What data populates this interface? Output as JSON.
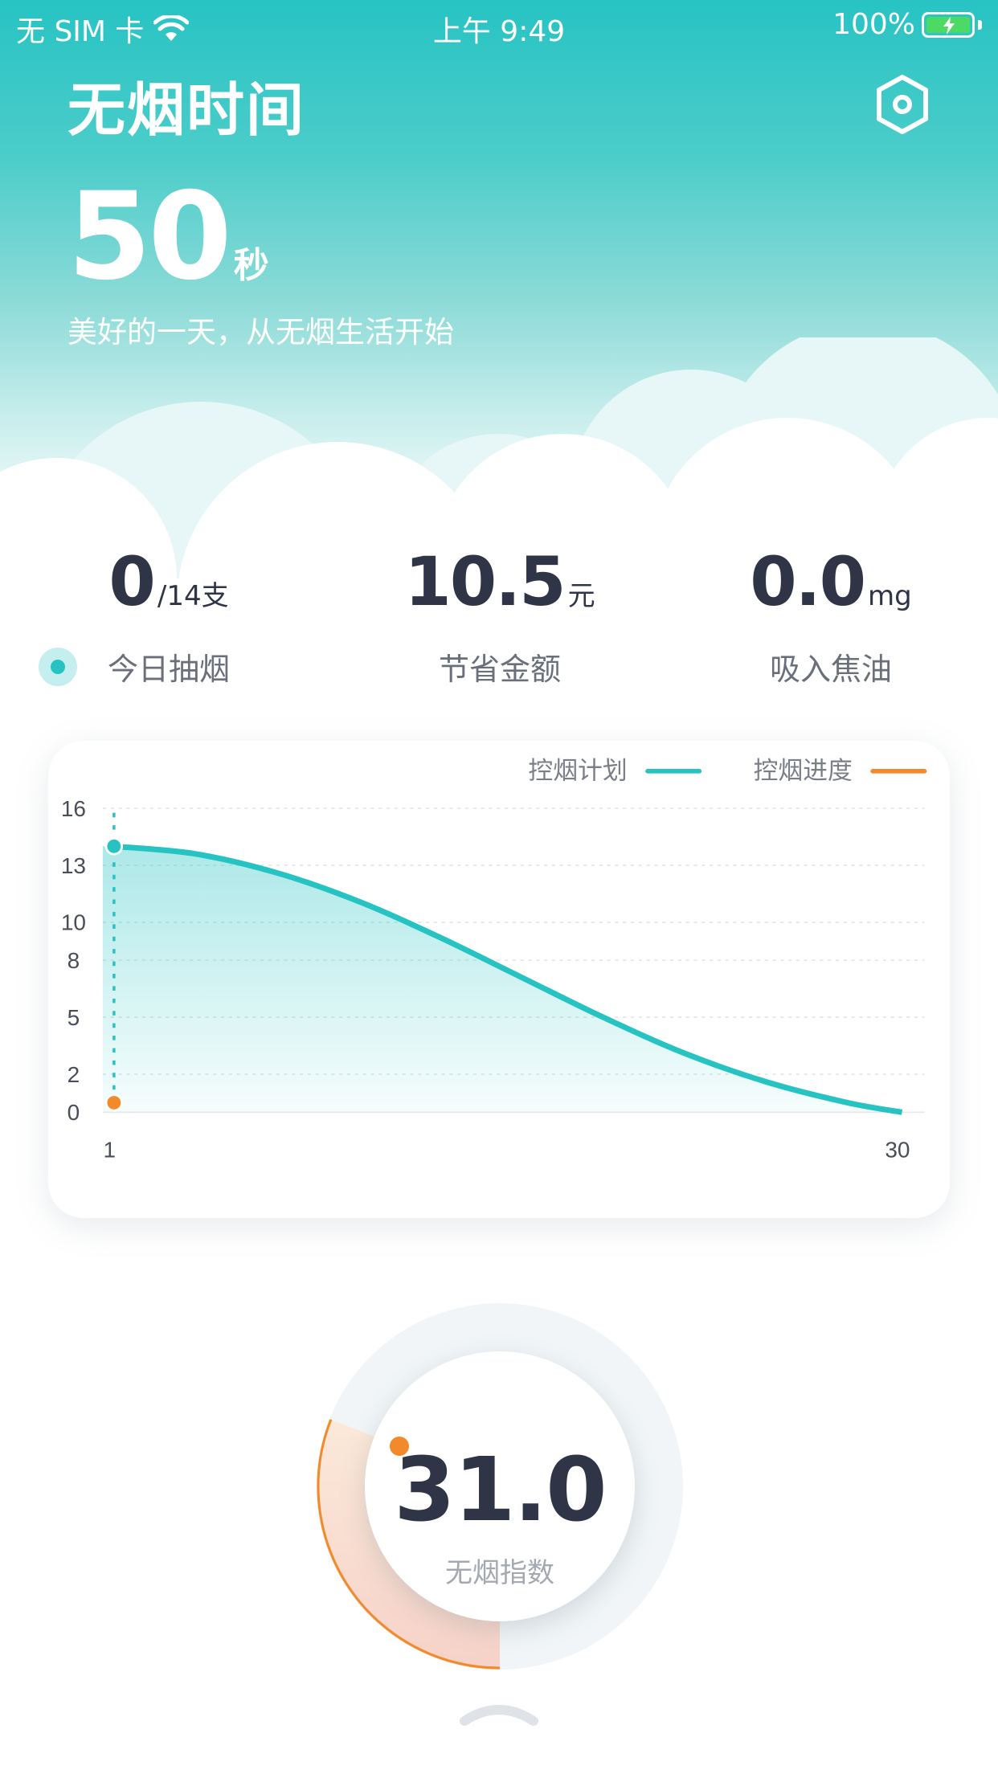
{
  "status_bar": {
    "carrier": "无 SIM 卡",
    "time": "上午 9:49",
    "battery": "100%"
  },
  "header": {
    "title": "无烟时间",
    "timer_value": "50",
    "timer_unit": "秒",
    "slogan": "美好的一天，从无烟生活开始"
  },
  "stats": [
    {
      "value": "0",
      "unit": "/14支",
      "label": "今日抽烟"
    },
    {
      "value": "10.5",
      "unit": "元",
      "label": "节省金额"
    },
    {
      "value": "0.0",
      "unit": "mg",
      "label": "吸入焦油"
    }
  ],
  "chart_data": {
    "type": "area",
    "x_ticks": [
      "1",
      "30"
    ],
    "y_ticks": [
      "16",
      "13",
      "10",
      "8",
      "5",
      "2",
      "0"
    ],
    "xlim": [
      1,
      30
    ],
    "ylim": [
      0,
      16
    ],
    "series": [
      {
        "name": "控烟计划",
        "color": "#27c3c3",
        "x": [
          1,
          4,
          7,
          10,
          13,
          16,
          19,
          22,
          25,
          28,
          30
        ],
        "values": [
          14,
          13.6,
          12.6,
          11.1,
          9.2,
          7.1,
          5.0,
          3.1,
          1.6,
          0.5,
          0
        ]
      },
      {
        "name": "控烟进度",
        "color": "#f28a2b",
        "x": [
          1
        ],
        "values": [
          0.5
        ]
      }
    ],
    "grid": true,
    "legend": "top-right"
  },
  "gauge": {
    "value": "31.0",
    "label": "无烟指数",
    "progress": 0.31,
    "color": "#f28a2b"
  },
  "colors": {
    "accent": "#27c3c3",
    "orange": "#f28a2b",
    "text": "#2f3447"
  },
  "icons": {
    "settings": "hexagon-settings-icon",
    "expand": "chevron-up-icon"
  }
}
